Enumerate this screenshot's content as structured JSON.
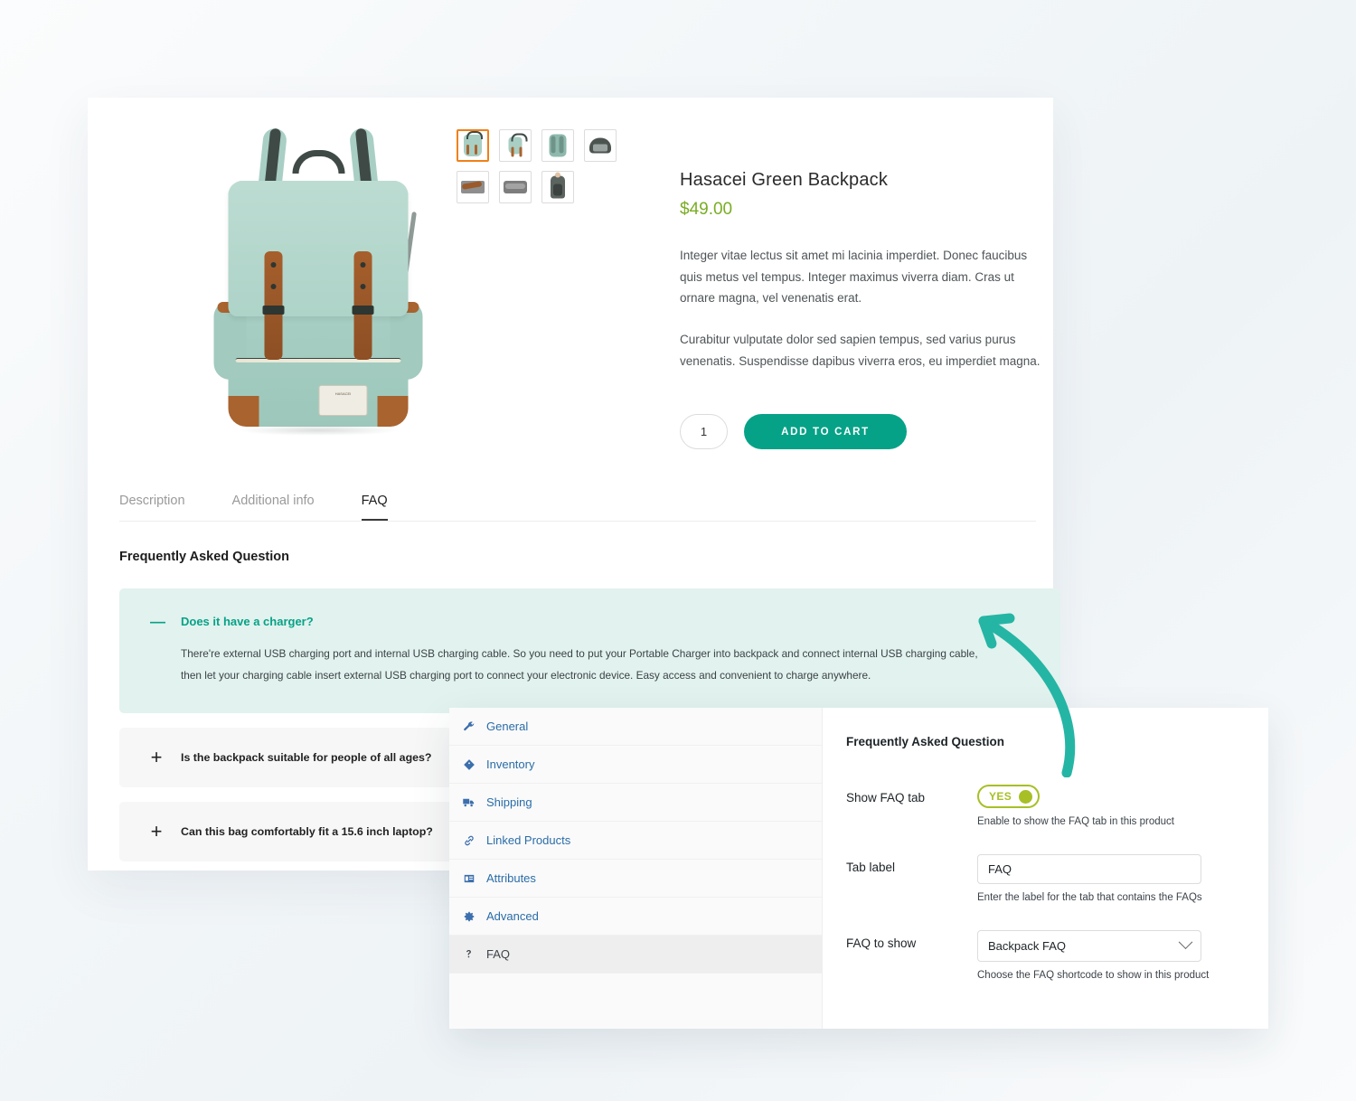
{
  "product": {
    "title": "Hasacei Green Backpack",
    "price": "$49.00",
    "description_1": " Integer vitae lectus sit amet mi lacinia imperdiet. Donec faucibus quis metus vel tempus. Integer maximus viverra diam. Cras ut ornare magna, vel venenatis erat.",
    "description_2": "Curabitur vulputate dolor sed sapien tempus, sed varius purus venenatis. Suspendisse dapibus viverra eros, eu imperdiet magna.",
    "quantity": "1",
    "add_to_cart_label": "ADD TO CART",
    "gallery": [
      {
        "name": "thumbnail-front",
        "active": true
      },
      {
        "name": "thumbnail-front-alt",
        "active": false
      },
      {
        "name": "thumbnail-back",
        "active": false
      },
      {
        "name": "thumbnail-open",
        "active": false
      },
      {
        "name": "thumbnail-strap-detail",
        "active": false
      },
      {
        "name": "thumbnail-folded",
        "active": false
      },
      {
        "name": "thumbnail-model",
        "active": false
      }
    ]
  },
  "tabs": [
    {
      "label": "Description",
      "active": false
    },
    {
      "label": "Additional info",
      "active": false
    },
    {
      "label": "FAQ",
      "active": true
    }
  ],
  "faq": {
    "heading": "Frequently Asked Question",
    "items": [
      {
        "question": "Does it have a charger?",
        "answer": "There're external USB charging port and internal USB charging cable. So you need to put your Portable Charger into backpack and connect internal USB charging cable, then let your charging cable insert external USB charging port to connect your electronic device. Easy access and convenient to charge anywhere.",
        "sign": "—",
        "open": true
      },
      {
        "question": "Is the backpack suitable for people of all ages?",
        "sign": "+",
        "open": false
      },
      {
        "question": "Can this bag comfortably fit a 15.6 inch laptop?",
        "sign": "+",
        "open": false
      }
    ]
  },
  "admin": {
    "tabs": [
      {
        "label": "General",
        "icon": "wrench-icon",
        "active": false
      },
      {
        "label": "Inventory",
        "icon": "tag-icon",
        "active": false
      },
      {
        "label": "Shipping",
        "icon": "truck-icon",
        "active": false
      },
      {
        "label": "Linked Products",
        "icon": "link-icon",
        "active": false
      },
      {
        "label": "Attributes",
        "icon": "attributes-icon",
        "active": false
      },
      {
        "label": "Advanced",
        "icon": "gear-icon",
        "active": false
      },
      {
        "label": "FAQ",
        "icon": "question-icon",
        "active": true
      }
    ],
    "form": {
      "heading": "Frequently Asked Question",
      "show_tab_label": "Show FAQ tab",
      "toggle_value": "YES",
      "show_tab_help": "Enable to show the FAQ tab in this product",
      "tab_label_label": "Tab label",
      "tab_label_value": "FAQ",
      "tab_label_help": "Enter the label for the tab that contains the FAQs",
      "faq_to_show_label": "FAQ to show",
      "faq_to_show_value": "Backpack FAQ",
      "faq_to_show_help": "Choose the FAQ shortcode to show in this product"
    }
  },
  "colors": {
    "accent_teal": "#06a287",
    "price_green": "#7aad23",
    "toggle_green": "#a8bf26",
    "admin_blue": "#2a6ca8",
    "thumb_active": "#f08018"
  },
  "annotation": {
    "arrow": "curved-arrow-pointing-to-faq-accordion"
  }
}
